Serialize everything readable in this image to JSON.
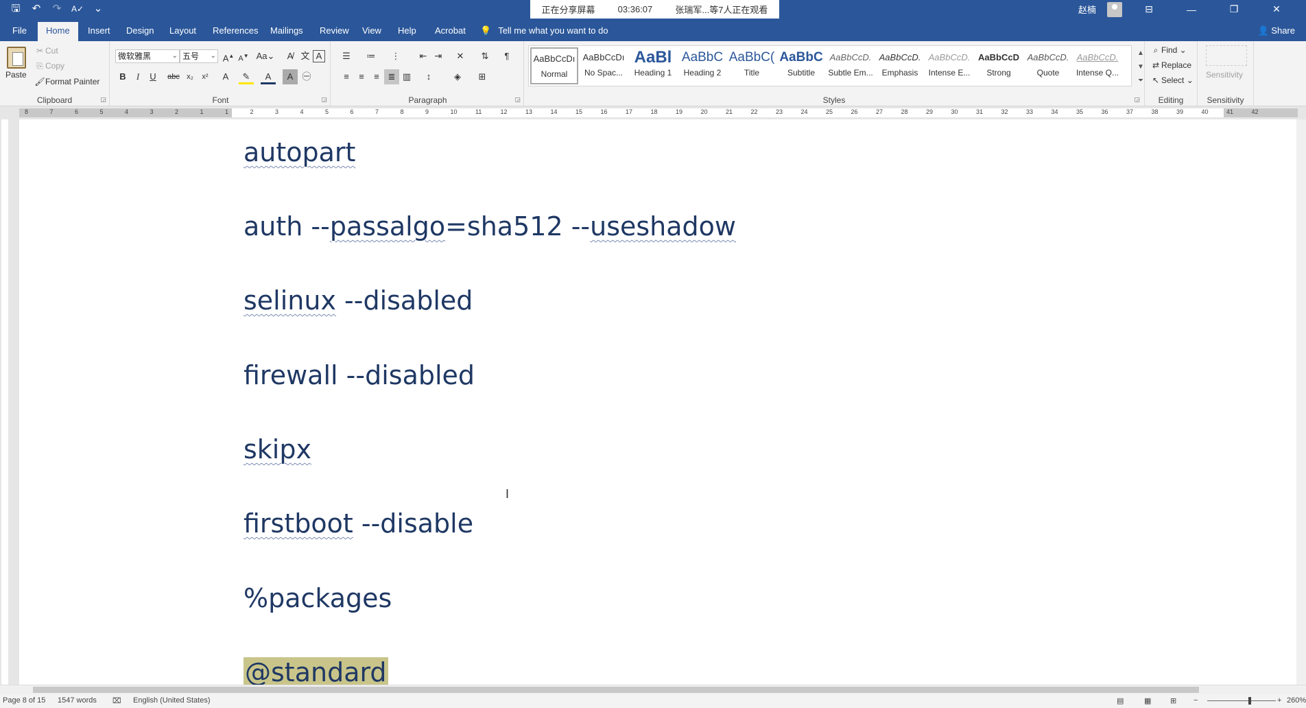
{
  "titlebar": {
    "qat": {
      "save": "🖫",
      "undo": "↶",
      "redo": "↷",
      "spelling": "A✓",
      "customize": "⌄"
    },
    "share_status": "正在分享屏幕",
    "share_time": "03:36:07",
    "viewers": "张瑞军...等7人正在观看",
    "user_name": "赵楠",
    "window_buttons": {
      "ribbon_display": "⊟",
      "minimize": "—",
      "restore": "❐",
      "close": "✕"
    }
  },
  "tabs": [
    "File",
    "Home",
    "Insert",
    "Design",
    "Layout",
    "References",
    "Mailings",
    "Review",
    "View",
    "Help",
    "Acrobat"
  ],
  "active_tab": "Home",
  "tell_me": "Tell me what you want to do",
  "share_label": "Share",
  "clipboard": {
    "label": "Clipboard",
    "paste": "Paste",
    "cut": "Cut",
    "copy": "Copy",
    "format_painter": "Format Painter"
  },
  "font": {
    "label": "Font",
    "family": "微软雅黑",
    "size": "五号"
  },
  "paragraph": {
    "label": "Paragraph"
  },
  "styles": {
    "label": "Styles",
    "items": [
      {
        "preview": "AaBbCcDı",
        "name": "Normal"
      },
      {
        "preview": "AaBbCcDı",
        "name": "No Spac..."
      },
      {
        "preview": "AaBl",
        "name": "Heading 1"
      },
      {
        "preview": "AaBbC",
        "name": "Heading 2"
      },
      {
        "preview": "AaBbC(",
        "name": "Title"
      },
      {
        "preview": "AaBbC",
        "name": "Subtitle"
      },
      {
        "preview": "AaBbCcD.",
        "name": "Subtle Em..."
      },
      {
        "preview": "AaBbCcD.",
        "name": "Emphasis"
      },
      {
        "preview": "AaBbCcD.",
        "name": "Intense E..."
      },
      {
        "preview": "AaBbCcD",
        "name": "Strong"
      },
      {
        "preview": "AaBbCcD.",
        "name": "Quote"
      },
      {
        "preview": "AaBbCcD.",
        "name": "Intense Q..."
      }
    ]
  },
  "editing": {
    "label": "Editing",
    "find": "Find",
    "replace": "Replace",
    "select": "Select"
  },
  "sensitivity": {
    "label": "Sensitivity",
    "button": "Sensitivity"
  },
  "ruler_numbers": [
    "8",
    "7",
    "6",
    "5",
    "4",
    "3",
    "2",
    "1",
    "1",
    "2",
    "3",
    "4",
    "5",
    "6",
    "7",
    "8",
    "9",
    "10",
    "11",
    "12",
    "13",
    "14",
    "15",
    "16",
    "17",
    "18",
    "19",
    "20",
    "21",
    "22",
    "23",
    "24",
    "25",
    "26",
    "27",
    "28",
    "29",
    "30",
    "31",
    "32",
    "33",
    "34",
    "35",
    "36",
    "37",
    "38",
    "39",
    "40",
    "41",
    "42"
  ],
  "document": {
    "lines": [
      {
        "parts": [
          "autopart"
        ]
      },
      {
        "parts": [
          "auth --",
          "passalgo",
          "=sha512 --",
          "useshadow"
        ]
      },
      {
        "parts": [
          "selinux",
          " --disabled"
        ]
      },
      {
        "parts": [
          "firewall --disabled"
        ]
      },
      {
        "parts": [
          "skipx"
        ]
      },
      {
        "parts": [
          "firstboot",
          " --disable"
        ]
      },
      {
        "parts": [
          "%packages"
        ]
      },
      {
        "parts": [
          "@standard"
        ]
      }
    ]
  },
  "status": {
    "page": "Page 8 of 15",
    "words": "1547 words",
    "language": "English (United States)",
    "zoom": "260%"
  },
  "colors": {
    "accent": "#2b579a",
    "doc_text": "#1f3864",
    "highlight": "#c9c58a"
  }
}
